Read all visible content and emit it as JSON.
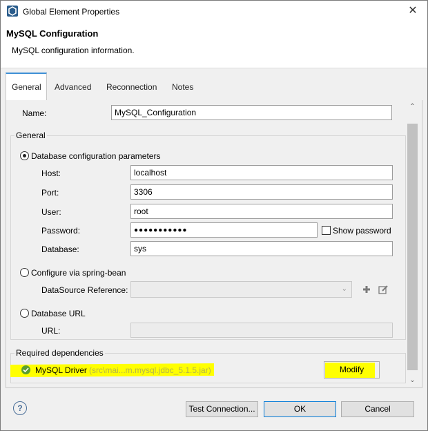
{
  "window": {
    "title": "Global Element Properties",
    "close_glyph": "✕"
  },
  "header": {
    "title": "MySQL Configuration",
    "description": "MySQL configuration information."
  },
  "tabs": [
    {
      "label": "General",
      "active": true
    },
    {
      "label": "Advanced"
    },
    {
      "label": "Reconnection"
    },
    {
      "label": "Notes"
    }
  ],
  "name_field": {
    "label": "Name:",
    "value": "MySQL_Configuration"
  },
  "general_group": {
    "title": "General",
    "db_params": {
      "label": "Database configuration parameters",
      "selected": true,
      "host": {
        "label": "Host:",
        "value": "localhost"
      },
      "port": {
        "label": "Port:",
        "value": "3306"
      },
      "user": {
        "label": "User:",
        "value": "root"
      },
      "password": {
        "label": "Password:",
        "value": "●●●●●●●●●●●"
      },
      "show_password": {
        "label": "Show password",
        "checked": false
      },
      "database": {
        "label": "Database:",
        "value": "sys"
      }
    },
    "spring_bean": {
      "label": "Configure via spring-bean",
      "selected": false,
      "datasource_label": "DataSource Reference:",
      "datasource_value": ""
    },
    "db_url": {
      "label": "Database URL",
      "selected": false,
      "url_label": "URL:",
      "url_value": ""
    }
  },
  "dependencies": {
    "title": "Required dependencies",
    "driver_label": "MySQL Driver",
    "driver_path": "(src\\mai...m.mysql.jdbc_5.1.5.jar)",
    "modify_label": "Modify"
  },
  "footer": {
    "help_glyph": "?",
    "test_label": "Test Connection...",
    "ok_label": "OK",
    "cancel_label": "Cancel"
  },
  "colors": {
    "accent": "#3e8fd6",
    "highlight": "#ffff00",
    "ok_icon": "#5a9e2f",
    "default_border": "#0078d7"
  }
}
